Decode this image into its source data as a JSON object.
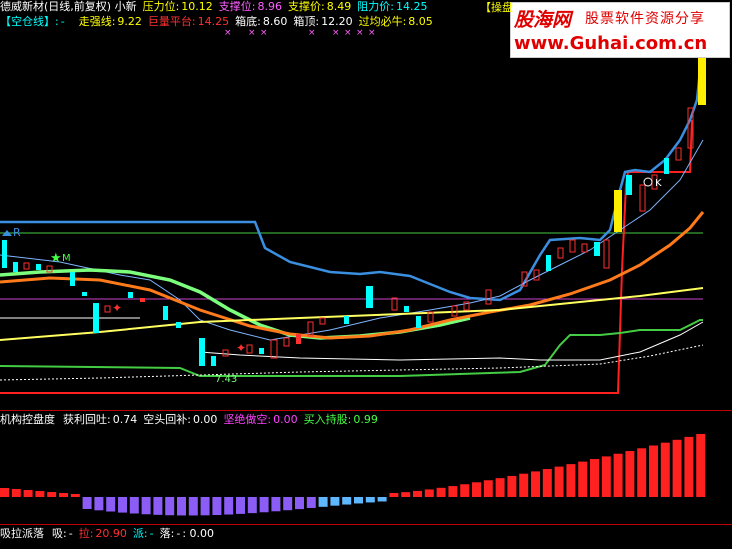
{
  "header": {
    "stock_title": "德威新材(日线,前复权) 小新",
    "pressure_label": "压力位:",
    "pressure_value": "10.12",
    "support_label": "支撑位:",
    "support_value": "8.96",
    "support_price_label": "支撑价:",
    "support_price_value": "8.49",
    "resistance_label": "阻力价:",
    "resistance_value": "14.25",
    "empty_line_label": "【空仓线】:",
    "empty_line_value": "-",
    "strong_line_label": "走强线:",
    "strong_line_value": "9.22",
    "volume_platform_label": "巨量平台:",
    "volume_platform_value": "14.25",
    "box_bottom_label": "箱底:",
    "box_bottom_value": "8.60",
    "box_top_label": "箱顶:",
    "box_top_value": "12.20",
    "bull_label": "过均必牛:",
    "bull_value": "8.05",
    "operate_tag": "【操盘",
    "marks": [
      "×",
      "×",
      "×",
      "×",
      "×",
      "×",
      "×",
      "×"
    ]
  },
  "watermark": {
    "logo": "股海网",
    "slogan": "股票软件资源分享",
    "url": "www.Guhai.com.cn"
  },
  "main_chart": {
    "markers": {
      "r_label": "R",
      "m_label": "M",
      "k_label": "K",
      "low_label": "7.43"
    },
    "colors": {
      "up": "#ff3030",
      "down": "#00ffff",
      "ma_blue": "#3b8fe0",
      "ma_green": "#7cff7c",
      "ma_orange": "#ff7a1a",
      "ma_yellow": "#ffff60",
      "ma_white": "#ffffff",
      "box": "#44cc44",
      "purple": "#cc44cc",
      "red_line": "#ff2020"
    }
  },
  "indicator": {
    "title": "机构控盘度",
    "profit_label": "获利回吐:",
    "profit_value": "0.74",
    "short_label": "空头回补:",
    "short_value": "0.00",
    "firm_short_label": "坚绝做空:",
    "firm_short_value": "0.00",
    "buy_hold_label": "买入持股:",
    "buy_hold_value": "0.99"
  },
  "bottom": {
    "title": "吸拉派落",
    "absorb_label": "吸:",
    "absorb_value": "-",
    "pull_label": "拉:",
    "pull_value": "20.90",
    "dispatch_label": "派:",
    "dispatch_value": "-",
    "fall_label": "落:",
    "fall_value": "-",
    "tail_value": ": 0.00"
  }
}
